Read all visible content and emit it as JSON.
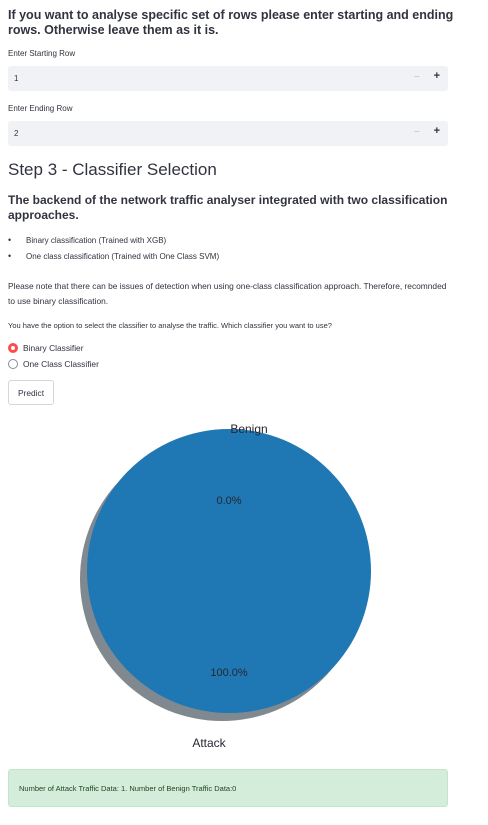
{
  "intro": {
    "text": "If you want to analyse specific set of rows please enter starting and ending rows. Otherwise leave them as it is."
  },
  "start_row": {
    "label": "Enter Starting Row",
    "value": "1",
    "minus": "−",
    "plus": "+"
  },
  "end_row": {
    "label": "Enter Ending Row",
    "value": "2",
    "minus": "−",
    "plus": "+"
  },
  "step3": {
    "title": "Step 3 - Classifier Selection",
    "description": "The backend of the network traffic analyser integrated with two classification approaches.",
    "bullets": [
      "Binary classification (Trained with XGB)",
      "One class classification (Trained with One Class SVM)"
    ],
    "note": "Please note that there can be issues of detection when using one-class classification approach. Therefore, recomnded to use binary classification."
  },
  "classifier": {
    "label": "You have the option to select the classifier to analyse the traffic. Which classifier you want to use?",
    "options": [
      {
        "label": "Binary Classifier",
        "selected": true
      },
      {
        "label": "One Class Classifier",
        "selected": false
      }
    ]
  },
  "predict_label": "Predict",
  "chart_data": {
    "type": "pie",
    "slices": [
      {
        "label": "Benign",
        "value": 0.0,
        "pct_text": "0.0%",
        "color": "#ff7f0e"
      },
      {
        "label": "Attack",
        "value": 100.0,
        "pct_text": "100.0%",
        "color": "#1f77b4"
      }
    ],
    "shadow": true
  },
  "result": {
    "text": "Number of Attack Traffic Data: 1. Number of Benign Traffic Data:0"
  },
  "colors": {
    "accent": "#ff4b4b",
    "success_bg": "#d4edda",
    "input_bg": "#f0f2f6"
  }
}
